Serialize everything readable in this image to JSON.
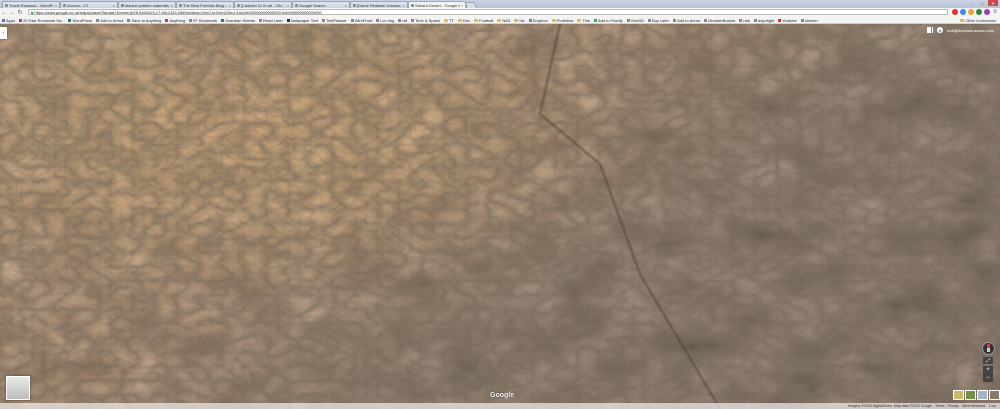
{
  "tabs": [
    {
      "title": "Travis Russeau - WordPr..."
    },
    {
      "title": "Ancora - CT"
    },
    {
      "title": "fashion pattern materials..."
    },
    {
      "title": "The Best Portfolio Blog..."
    },
    {
      "title": "[Castello 2x 5 nat - Glo..."
    },
    {
      "title": "Google Search"
    },
    {
      "title": "[Dome Realistic Volcano..."
    },
    {
      "title": "Sahara Desert - Google M..."
    }
  ],
  "window_controls": {
    "minimize": "–",
    "maximize": "□",
    "close": "✕"
  },
  "nav": {
    "back": "←",
    "forward": "→",
    "reload": "↻"
  },
  "address": {
    "url": "https://www.google.co.uk/maps/place/Sahara+Desert/@26.6483429,17.6611433,9469m/data=!3m1!1e3!4m2!3m1!1s0x0000000000000000:0x0000000000000000"
  },
  "bookmarks": [
    {
      "label": "Apps",
      "color": "#4a7bd0"
    },
    {
      "label": "20 Fast Rockwork Sa...",
      "color": "#d33"
    },
    {
      "label": "WordPress",
      "color": "#21759b"
    },
    {
      "label": "Add to Arena",
      "color": "#888"
    },
    {
      "label": "Save to Anything",
      "color": "#888"
    },
    {
      "label": "Anything",
      "color": "#d33"
    },
    {
      "label": "FF Bookmark",
      "color": "#888"
    },
    {
      "label": "Guardian Sheets",
      "color": "#2a8a3a"
    },
    {
      "label": "Read Later",
      "color": "#888"
    },
    {
      "label": "Instapaper Text",
      "color": "#333"
    },
    {
      "label": "TextPlasser",
      "color": "#888"
    },
    {
      "label": "WireFront",
      "color": "#888"
    },
    {
      "label": "t.cn img",
      "color": "#888"
    },
    {
      "label": "rat",
      "color": "#888"
    },
    {
      "label": "Time & Space",
      "color": "#888"
    },
    {
      "label": "TT",
      "color": "#e6b84a",
      "folder": true
    },
    {
      "label": "Dev",
      "color": "#e6b84a",
      "folder": true
    },
    {
      "label": "Football",
      "color": "#e6b84a",
      "folder": true
    },
    {
      "label": "NAS",
      "color": "#e6b84a",
      "folder": true
    },
    {
      "label": "biz",
      "color": "#e6b84a",
      "folder": true
    },
    {
      "label": "Dropbox",
      "color": "#3d8fd9"
    },
    {
      "label": "Portfolios",
      "color": "#e6b84a",
      "folder": true
    },
    {
      "label": "This",
      "color": "#e6b84a",
      "folder": true
    },
    {
      "label": "Add to Feedly",
      "color": "#2bb24c"
    },
    {
      "label": "VidsSD",
      "color": "#888"
    },
    {
      "label": "Buy Later",
      "color": "#888"
    },
    {
      "label": "Add to Arena",
      "color": "#888"
    },
    {
      "label": "MonsterBoards",
      "color": "#888"
    },
    {
      "label": "nab",
      "color": "#888"
    },
    {
      "label": "dayofight",
      "color": "#888"
    },
    {
      "label": "Youtube",
      "color": "#d33"
    },
    {
      "label": "shinner",
      "color": "#888"
    }
  ],
  "other_bookmarks": {
    "label": "Other bookmarks"
  },
  "map": {
    "user_email": "bob@thomasrusseau.com",
    "google_label": "Google",
    "footer": [
      "Imagery ©2015 DigitalGlobe, Map data ©2015 Google",
      "Terms",
      "Privacy",
      "Send feedback",
      "1 km"
    ]
  },
  "colors": {
    "accent": "#4285f4",
    "desert": "#c7a174",
    "rock": "#5c5046"
  }
}
